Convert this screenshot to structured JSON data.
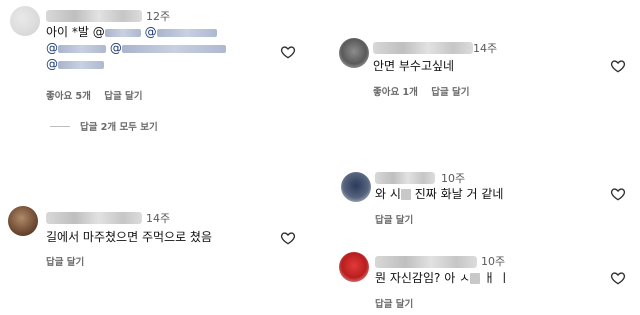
{
  "comments_left": [
    {
      "time": "12주",
      "text_lead": "아이 *발 @",
      "mention_at": "@",
      "meta": {
        "likes": "좋아요 5개",
        "reply": "답글 달기"
      },
      "view_replies": "답글 2개 모두 보기"
    },
    {
      "time": "14주",
      "text": "길에서 마주쳤으면 주먹으로 쳤음",
      "meta": {
        "reply": "답글 달기"
      }
    }
  ],
  "comments_right": [
    {
      "time": "14주",
      "text": "안면 부수고싶네",
      "meta": {
        "likes": "좋아요 1개",
        "reply": "답글 달기"
      }
    },
    {
      "time": "10주",
      "text_a": "와 시",
      "text_b": " 진짜 화날 거 같네",
      "meta": {
        "reply": "답글 달기"
      }
    },
    {
      "time": "10주",
      "text_a": "뭔 자신감임? 아 ㅅ",
      "text_b": " ㅐ ㅣ",
      "meta": {
        "reply": "답글 달기"
      }
    }
  ],
  "icons": {
    "like": "heart-outline-icon"
  },
  "colors": {
    "text": "#111111",
    "meta": "#6b6b6b",
    "mention": "#1b3a7a"
  }
}
